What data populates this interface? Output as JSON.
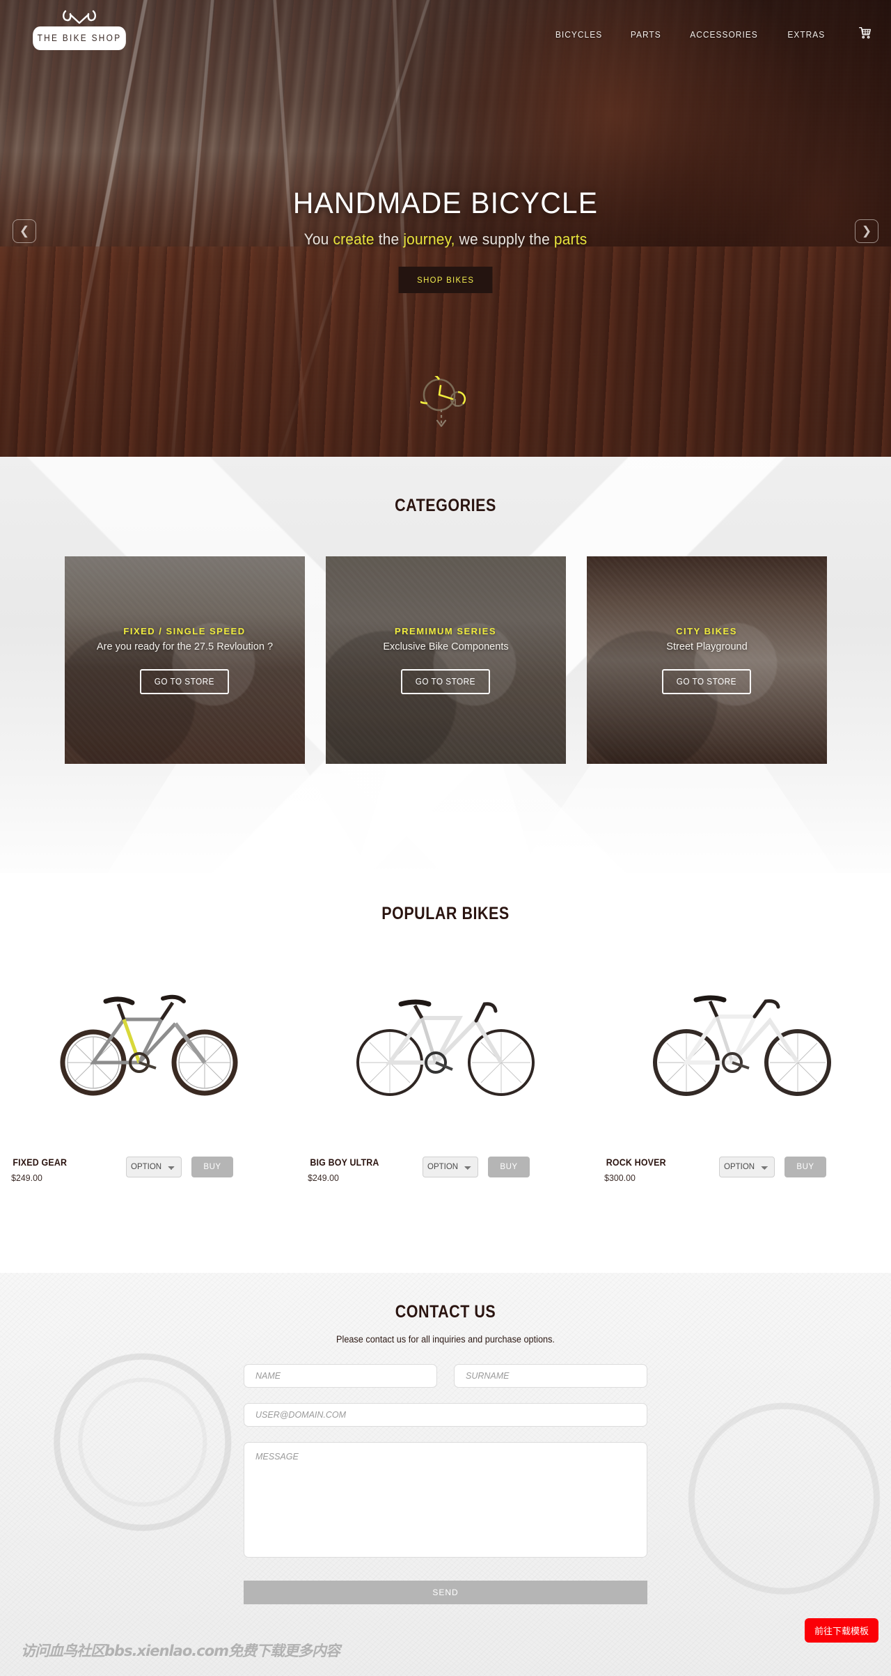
{
  "header": {
    "logo_text": "THE BIKE SHOP",
    "nav": [
      {
        "label": "BICYCLES"
      },
      {
        "label": "PARTS"
      },
      {
        "label": "ACCESSORIES"
      },
      {
        "label": "EXTRAS"
      }
    ],
    "cart_icon": "shopping-cart-icon"
  },
  "hero": {
    "title": "HANDMADE BICYCLE",
    "sub_1": "You ",
    "sub_hl_1": "create",
    "sub_2": " the ",
    "sub_hl_2": "journey,",
    "sub_3": " we supply the ",
    "sub_hl_3": "parts",
    "cta": "SHOP BIKES",
    "prev_arrow": "chevron-left-icon",
    "next_arrow": "chevron-right-icon",
    "scroll_indicator": "scroll-down-icon",
    "accent_color": "#e8e43c",
    "cta_bg": "#241410"
  },
  "categories": {
    "title": "CATEGORIES",
    "cards": [
      {
        "label": "FIXED / SINGLE SPEED",
        "desc": "Are you ready for the 27.5 Revloution ?",
        "button": "GO TO STORE"
      },
      {
        "label": "PREMIMUM SERIES",
        "desc": "Exclusive Bike Components",
        "button": "GO TO STORE"
      },
      {
        "label": "CITY BIKES",
        "desc": "Street Playground",
        "button": "GO TO STORE"
      }
    ]
  },
  "popular": {
    "title": "POPULAR BIKES",
    "products": [
      {
        "name": "FIXED GEAR",
        "price": "$249.00",
        "option": "OPTION",
        "buy": "BUY"
      },
      {
        "name": "BIG BOY ULTRA",
        "price": "$249.00",
        "option": "OPTION",
        "buy": "BUY"
      },
      {
        "name": "ROCK HOVER",
        "price": "$300.00",
        "option": "OPTION",
        "buy": "BUY"
      }
    ]
  },
  "contact": {
    "title": "CONTACT US",
    "subtitle": "Please contact us for all inquiries and purchase options.",
    "name_placeholder": "NAME",
    "surname_placeholder": "SURNAME",
    "email_placeholder": "USER@DOMAIN.COM",
    "message_placeholder": "MESSAGE",
    "send": "SEND"
  },
  "overlay": {
    "watermark": "访问血鸟社区bbs.xienlao.com免费下载更多内容",
    "download_button": "前往下载模板",
    "download_color": "#fb0007"
  }
}
